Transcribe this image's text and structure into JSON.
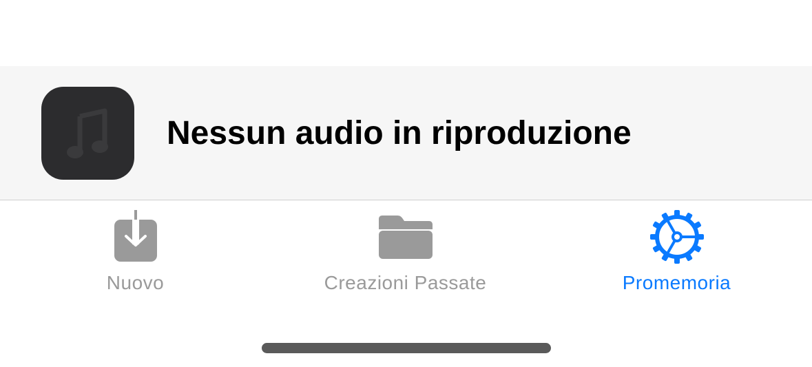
{
  "now_playing": {
    "artwork_icon": "music-note-icon",
    "title": "Nessun audio in riproduzione"
  },
  "tabbar": {
    "active_color": "#0a7aff",
    "inactive_color": "#9a9a9a",
    "tabs": [
      {
        "label": "Nuovo",
        "icon": "download-tray-icon",
        "active": false
      },
      {
        "label": "Creazioni Passate",
        "icon": "folder-icon",
        "active": false
      },
      {
        "label": "Promemoria",
        "icon": "gear-icon",
        "active": true
      }
    ]
  }
}
